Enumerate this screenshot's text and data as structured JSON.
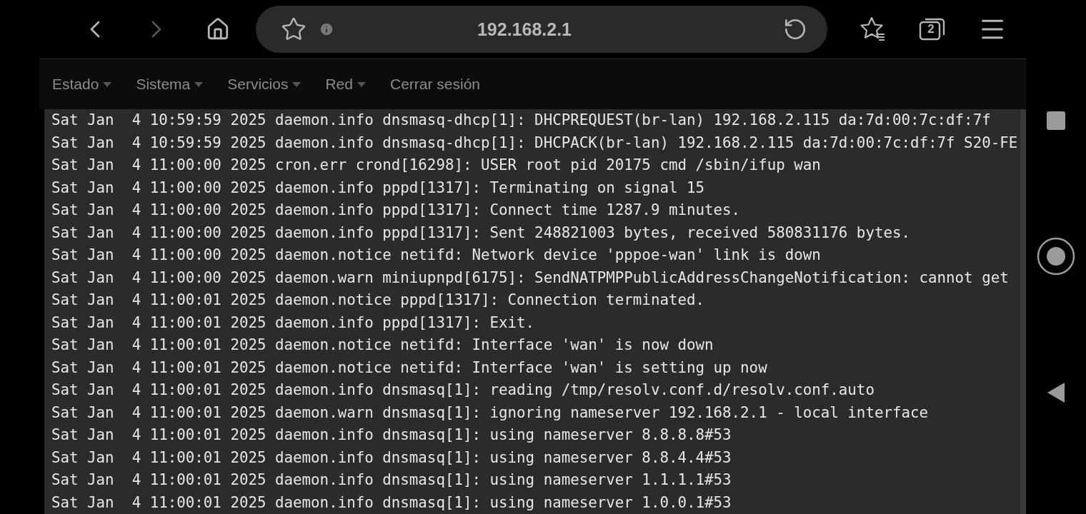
{
  "browser": {
    "url": "192.168.2.1",
    "tab_count": "2",
    "back": {
      "disabled": false
    },
    "forward": {
      "disabled": true
    }
  },
  "menu": [
    {
      "label": "Estado",
      "has_menu": true
    },
    {
      "label": "Sistema",
      "has_menu": true
    },
    {
      "label": "Servicios",
      "has_menu": true
    },
    {
      "label": "Red",
      "has_menu": true
    },
    {
      "label": "Cerrar sesión",
      "has_menu": false
    }
  ],
  "log": [
    "Sat Jan  4 10:59:59 2025 daemon.info dnsmasq-dhcp[1]: DHCPREQUEST(br-lan) 192.168.2.115 da:7d:00:7c:df:7f",
    "Sat Jan  4 10:59:59 2025 daemon.info dnsmasq-dhcp[1]: DHCPACK(br-lan) 192.168.2.115 da:7d:00:7c:df:7f S20-FE",
    "Sat Jan  4 11:00:00 2025 cron.err crond[16298]: USER root pid 20175 cmd /sbin/ifup wan",
    "Sat Jan  4 11:00:00 2025 daemon.info pppd[1317]: Terminating on signal 15",
    "Sat Jan  4 11:00:00 2025 daemon.info pppd[1317]: Connect time 1287.9 minutes.",
    "Sat Jan  4 11:00:00 2025 daemon.info pppd[1317]: Sent 248821003 bytes, received 580831176 bytes.",
    "Sat Jan  4 11:00:00 2025 daemon.notice netifd: Network device 'pppoe-wan' link is down",
    "Sat Jan  4 11:00:00 2025 daemon.warn miniupnpd[6175]: SendNATPMPPublicAddressChangeNotification: cannot get",
    "Sat Jan  4 11:00:01 2025 daemon.notice pppd[1317]: Connection terminated.",
    "Sat Jan  4 11:00:01 2025 daemon.info pppd[1317]: Exit.",
    "Sat Jan  4 11:00:01 2025 daemon.notice netifd: Interface 'wan' is now down",
    "Sat Jan  4 11:00:01 2025 daemon.notice netifd: Interface 'wan' is setting up now",
    "Sat Jan  4 11:00:01 2025 daemon.info dnsmasq[1]: reading /tmp/resolv.conf.d/resolv.conf.auto",
    "Sat Jan  4 11:00:01 2025 daemon.warn dnsmasq[1]: ignoring nameserver 192.168.2.1 - local interface",
    "Sat Jan  4 11:00:01 2025 daemon.info dnsmasq[1]: using nameserver 8.8.8.8#53",
    "Sat Jan  4 11:00:01 2025 daemon.info dnsmasq[1]: using nameserver 8.8.4.4#53",
    "Sat Jan  4 11:00:01 2025 daemon.info dnsmasq[1]: using nameserver 1.1.1.1#53",
    "Sat Jan  4 11:00:01 2025 daemon.info dnsmasq[1]: using nameserver 1.0.0.1#53"
  ]
}
